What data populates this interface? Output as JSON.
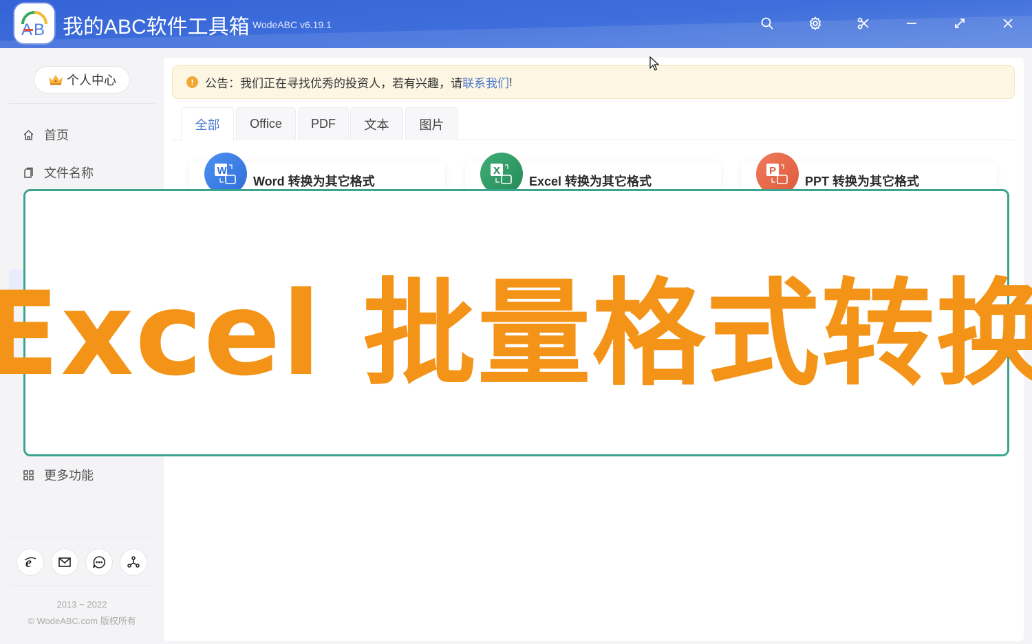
{
  "window": {
    "app_title": "我的ABC软件工具箱",
    "version": "WodeABC v6.19.1",
    "logo_text": "AB",
    "controls": [
      {
        "name": "search-icon",
        "label": "搜索"
      },
      {
        "name": "settings-icon",
        "label": "设置"
      },
      {
        "name": "scissors-icon",
        "label": "截图"
      },
      {
        "name": "minimize-icon",
        "label": "最小化"
      },
      {
        "name": "maximize-icon",
        "label": "最大化"
      },
      {
        "name": "close-icon",
        "label": "关闭"
      }
    ]
  },
  "sidebar": {
    "user_center": "个人中心",
    "items": [
      {
        "label": "首页",
        "icon": "home-icon"
      },
      {
        "label": "文件名称",
        "icon": "file-icon"
      },
      {
        "label": "更多功能",
        "icon": "grid-icon"
      }
    ],
    "social": [
      "ie-browser-icon",
      "mail-icon",
      "chat-icon",
      "share-network-icon"
    ],
    "footer_years": "2013 ~ 2022",
    "footer_copyright": "© WodeABC.com 版权所有"
  },
  "main": {
    "notice": {
      "prefix": "公告：我们正在寻找优秀的投资人，若有兴趣，请",
      "link": "联系我们",
      "suffix": "!"
    },
    "tabs": [
      {
        "label": "全部",
        "active": true
      },
      {
        "label": "Office",
        "active": false
      },
      {
        "label": "PDF",
        "active": false
      },
      {
        "label": "文本",
        "active": false
      },
      {
        "label": "图片",
        "active": false
      }
    ],
    "cards": [
      {
        "label": "Word 转换为其它格式",
        "badge": "W",
        "color": "#3a7be0"
      },
      {
        "label": "Excel 转换为其它格式",
        "badge": "X",
        "color": "#2f9a66"
      },
      {
        "label": "PPT 转换为其它格式",
        "badge": "P",
        "color": "#e8674a"
      }
    ]
  },
  "overlay": {
    "title": "Excel 批量格式转换",
    "text_color": "#f39418",
    "border_color": "#3aa48e"
  }
}
